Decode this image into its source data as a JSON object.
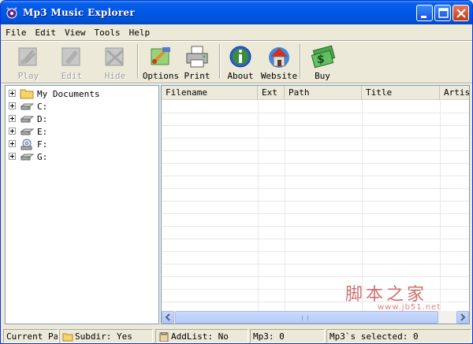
{
  "window": {
    "title": "Mp3 Music Explorer"
  },
  "menu": [
    "File",
    "Edit",
    "View",
    "Tools",
    "Help"
  ],
  "toolbar": [
    {
      "label": "Play",
      "enabled": false,
      "icon": "play-icon"
    },
    {
      "label": "Edit",
      "enabled": false,
      "icon": "edit-icon"
    },
    {
      "label": "Hide",
      "enabled": false,
      "icon": "hide-icon"
    },
    {
      "label": "Options",
      "enabled": true,
      "icon": "options-icon"
    },
    {
      "label": "Print",
      "enabled": true,
      "icon": "printer-icon"
    },
    {
      "label": "About",
      "enabled": true,
      "icon": "info-icon"
    },
    {
      "label": "Website",
      "enabled": true,
      "icon": "house-icon"
    },
    {
      "label": "Buy",
      "enabled": true,
      "icon": "money-icon"
    }
  ],
  "tree": [
    {
      "label": "My Documents",
      "icon": "folder-icon"
    },
    {
      "label": "C:",
      "icon": "drive-icon"
    },
    {
      "label": "D:",
      "icon": "drive-icon"
    },
    {
      "label": "E:",
      "icon": "drive-icon"
    },
    {
      "label": "F:",
      "icon": "cd-drive-icon"
    },
    {
      "label": "G:",
      "icon": "drive-icon"
    }
  ],
  "list": {
    "columns": [
      "Filename",
      "Ext",
      "Path",
      "Title",
      "Artis"
    ]
  },
  "watermark": {
    "text": "脚本之家",
    "url": "www.jb51.net"
  },
  "status": {
    "current_path": "Current Pat",
    "subdir": "Subdir: Yes",
    "addlist": "AddList: No",
    "mp3": "Mp3: 0",
    "selected": "Mp3`s selected: 0"
  },
  "colors": {
    "titlebar": "#0058e8",
    "window_bg": "#ece9d8",
    "close_button": "#c43a16"
  }
}
